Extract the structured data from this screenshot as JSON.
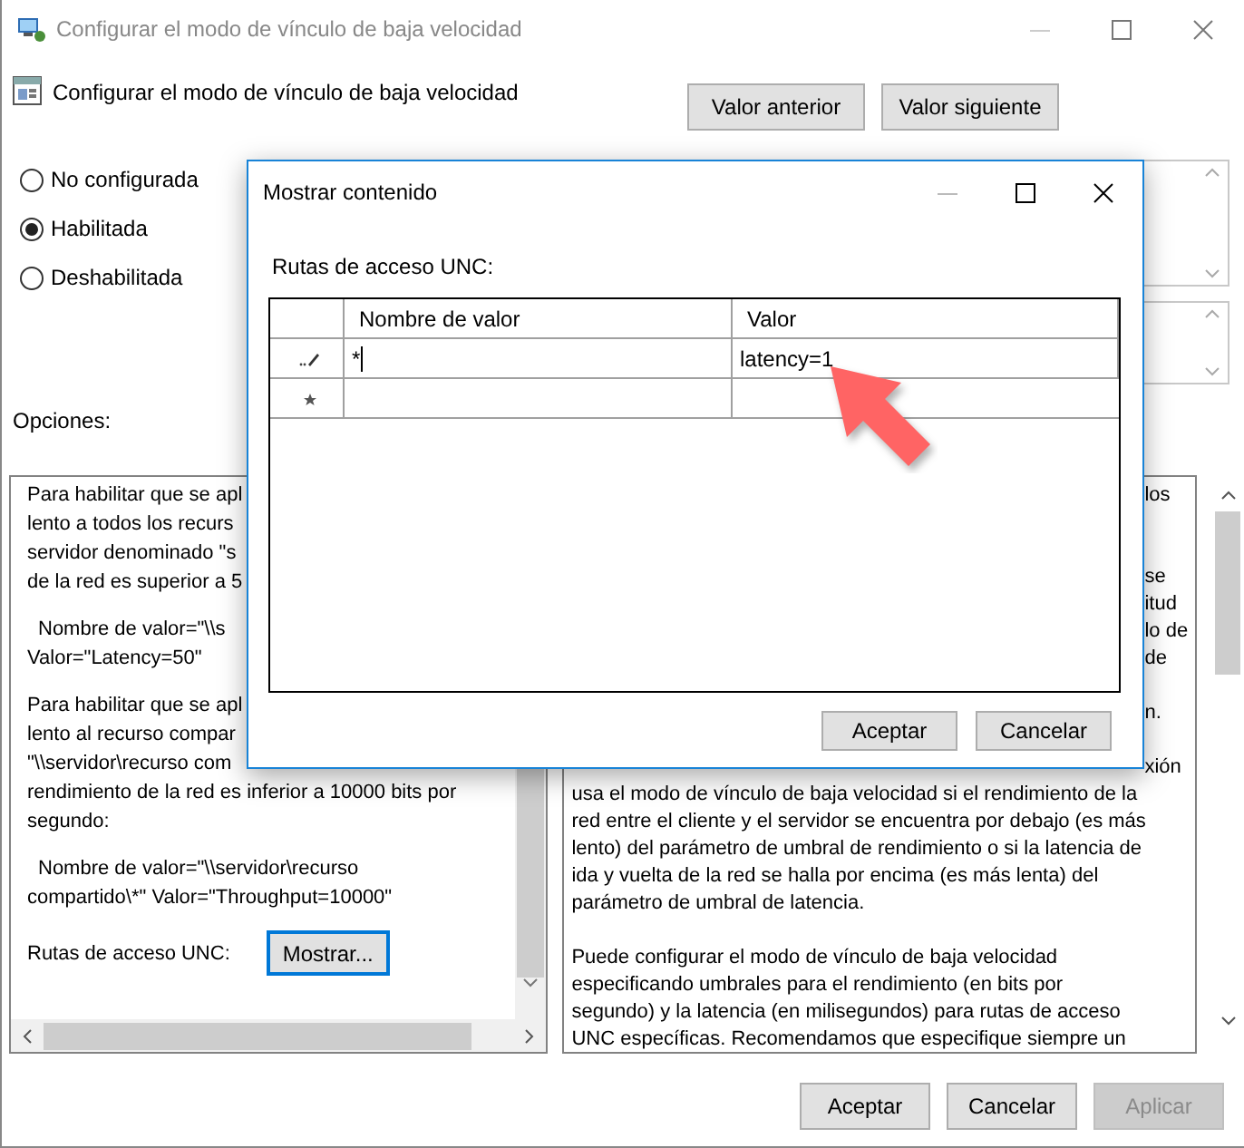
{
  "window": {
    "title": "Configurar el modo de vínculo de baja velocidad"
  },
  "header": {
    "title": "Configurar el modo de vínculo de baja velocidad"
  },
  "nav_buttons": [
    {
      "label": "Valor anterior"
    },
    {
      "label": "Valor siguiente"
    }
  ],
  "state_options": [
    {
      "label": "No configurada",
      "selected": false
    },
    {
      "label": "Habilitada",
      "selected": true
    },
    {
      "label": "Deshabilitada",
      "selected": false
    }
  ],
  "options_label": "Opciones:",
  "options_panel": {
    "paragraphs": [
      {
        "indented": false,
        "lines": [
          "Para habilitar que se apl",
          "lento a todos los recurs",
          "servidor denominado \"s",
          "de la red es superior a 5"
        ]
      },
      {
        "indented": true,
        "lines": [
          "Nombre de valor=\"\\\\s",
          "Valor=\"Latency=50\""
        ]
      },
      {
        "indented": false,
        "lines": [
          "Para habilitar que se apl",
          "lento al recurso compar",
          "\"\\\\servidor\\recurso com",
          "rendimiento de la red es inferior a 10000 bits por",
          "segundo:"
        ]
      },
      {
        "indented": true,
        "lines": [
          "Nombre de valor=\"\\\\servidor\\recurso",
          "compartido\\*\" Valor=\"Throughput=10000\""
        ]
      }
    ],
    "field_label": "Rutas de acceso UNC:",
    "button": "Mostrar..."
  },
  "help_panel": {
    "lines": [
      {
        "kind": "tail",
        "text": "los"
      },
      {
        "kind": "covered"
      },
      {
        "kind": "covered"
      },
      {
        "kind": "tail",
        "text": "se"
      },
      {
        "kind": "tail",
        "text": "itud"
      },
      {
        "kind": "tail",
        "text": "lo de"
      },
      {
        "kind": "tail",
        "text": "de"
      },
      {
        "kind": "covered"
      },
      {
        "kind": "tail",
        "text": "n."
      },
      {
        "kind": "covered"
      },
      {
        "kind": "tail",
        "text": "xión"
      },
      {
        "kind": "line",
        "text": "usa el modo de vínculo de baja velocidad si el rendimiento de la"
      },
      {
        "kind": "line",
        "text": "red entre el cliente y el servidor se encuentra por debajo (es más"
      },
      {
        "kind": "line",
        "text": "lento) del parámetro de umbral de rendimiento o si la latencia de"
      },
      {
        "kind": "line",
        "text": "ida y vuelta de la red se halla por encima (es más lenta) del"
      },
      {
        "kind": "line",
        "text": "parámetro de umbral de latencia."
      },
      {
        "kind": "covered"
      },
      {
        "kind": "line",
        "text": "Puede configurar el modo de vínculo de baja velocidad"
      },
      {
        "kind": "line",
        "text": "especificando umbrales para el rendimiento (en bits por"
      },
      {
        "kind": "line",
        "text": "segundo) y la latencia (en milisegundos) para rutas de acceso"
      },
      {
        "kind": "line",
        "text": "UNC específicas. Recomendamos que especifique siempre un"
      }
    ]
  },
  "footer_buttons": [
    {
      "label": "Aceptar",
      "disabled": false
    },
    {
      "label": "Cancelar",
      "disabled": false
    },
    {
      "label": "Aplicar",
      "disabled": true
    }
  ],
  "dialog": {
    "title": "Mostrar contenido",
    "label": "Rutas de acceso UNC:",
    "columns": [
      "Nombre de valor",
      "Valor"
    ],
    "rows": [
      {
        "kind": "editing",
        "cells": [
          "*",
          "latency=1"
        ]
      },
      {
        "kind": "new"
      }
    ],
    "buttons": [
      "Aceptar",
      "Cancelar"
    ]
  }
}
